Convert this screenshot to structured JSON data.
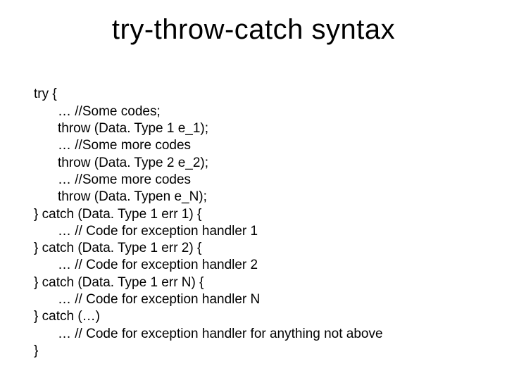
{
  "title": "try-throw-catch syntax",
  "lines": {
    "l0": "try {",
    "l1": "… //Some codes;",
    "l2": "throw (Data. Type 1 e_1);",
    "l3": "… //Some more codes",
    "l4": "throw (Data. Type 2 e_2);",
    "l5": "… //Some more codes",
    "l6": "throw (Data. Typen e_N);",
    "l7": "} catch (Data. Type 1 err 1) {",
    "l8": "… // Code for exception handler 1",
    "l9": "} catch (Data. Type 1 err 2) {",
    "l10": "… // Code for exception handler 2",
    "l11": "} catch (Data. Type 1 err N) {",
    "l12": "… // Code for exception handler N",
    "l13": "} catch (…)",
    "l14": "… // Code for exception handler for anything not above",
    "l15": "}"
  }
}
